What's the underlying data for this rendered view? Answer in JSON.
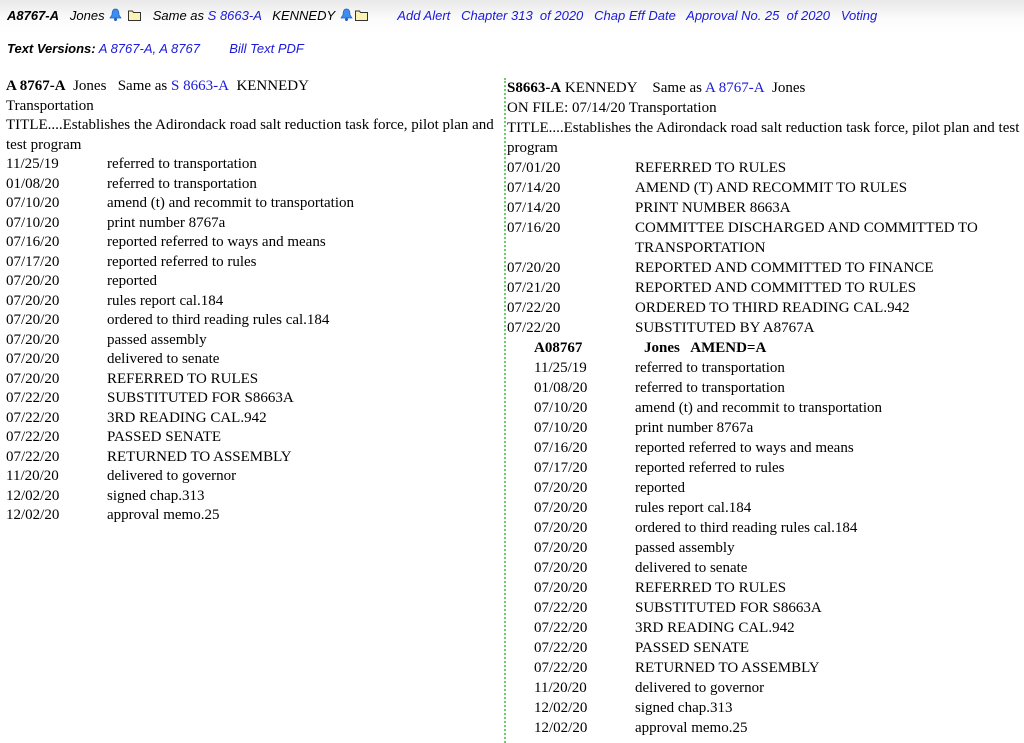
{
  "header": {
    "bill_id": "A8767-A",
    "sponsor": "Jones",
    "same_as_label": "Same as",
    "same_as_link": "S 8663-A",
    "same_as_sponsor": "KENNEDY",
    "links": [
      "Add Alert",
      "Chapter 313  of 2020",
      "Chap Eff Date",
      "Approval No. 25  of 2020",
      "Voting"
    ],
    "text_versions_label": "Text Versions:",
    "text_versions": "A 8767-A, A 8767",
    "bill_text_pdf": "Bill Text PDF"
  },
  "left": {
    "bill_id": "A 8767-A",
    "sponsor": "Jones",
    "same_as_label": "Same as",
    "same_as_link": "S 8663-A",
    "same_as_sponsor": "KENNEDY",
    "committee": "Transportation",
    "title": "TITLE....Establishes the Adirondack road salt reduction task force, pilot plan and test program",
    "events": [
      {
        "date": "11/25/19",
        "action": "referred to transportation"
      },
      {
        "date": "01/08/20",
        "action": "referred to transportation"
      },
      {
        "date": "07/10/20",
        "action": "amend (t) and recommit to transportation"
      },
      {
        "date": "07/10/20",
        "action": "print number 8767a"
      },
      {
        "date": "07/16/20",
        "action": "reported referred to ways and means"
      },
      {
        "date": "07/17/20",
        "action": "reported referred to rules"
      },
      {
        "date": "07/20/20",
        "action": "reported"
      },
      {
        "date": "07/20/20",
        "action": "rules report cal.184"
      },
      {
        "date": "07/20/20",
        "action": "ordered to third reading rules cal.184"
      },
      {
        "date": "07/20/20",
        "action": "passed assembly"
      },
      {
        "date": "07/20/20",
        "action": "delivered to senate"
      },
      {
        "date": "07/20/20",
        "action": "REFERRED TO RULES"
      },
      {
        "date": "07/22/20",
        "action": "SUBSTITUTED FOR S8663A"
      },
      {
        "date": "07/22/20",
        "action": "3RD READING CAL.942"
      },
      {
        "date": "07/22/20",
        "action": "PASSED SENATE"
      },
      {
        "date": "07/22/20",
        "action": "RETURNED TO ASSEMBLY"
      },
      {
        "date": "11/20/20",
        "action": "delivered to governor"
      },
      {
        "date": "12/02/20",
        "action": "signed chap.313"
      },
      {
        "date": "12/02/20",
        "action": "approval memo.25"
      }
    ]
  },
  "right": {
    "bill_id": "S8663-A",
    "sponsor": "KENNEDY",
    "same_as_label": "Same as",
    "same_as_link": "A 8767-A",
    "same_as_sponsor": "Jones",
    "on_file": "ON FILE: 07/14/20 Transportation",
    "title": "TITLE....Establishes the Adirondack road salt reduction task force, pilot plan and test program",
    "events": [
      {
        "date": "07/01/20",
        "action": "REFERRED TO RULES"
      },
      {
        "date": "07/14/20",
        "action": "AMEND (T) AND RECOMMIT TO RULES"
      },
      {
        "date": "07/14/20",
        "action": "PRINT NUMBER 8663A"
      },
      {
        "date": "07/16/20",
        "action": "COMMITTEE DISCHARGED AND COMMITTED TO TRANSPORTATION"
      },
      {
        "date": "07/20/20",
        "action": "REPORTED AND COMMITTED TO FINANCE"
      },
      {
        "date": "07/21/20",
        "action": "REPORTED AND COMMITTED TO RULES"
      },
      {
        "date": "07/22/20",
        "action": "ORDERED TO THIRD READING CAL.942"
      },
      {
        "date": "07/22/20",
        "action": "SUBSTITUTED BY A8767A"
      }
    ],
    "substitute": {
      "bill": "A08767",
      "info": "Jones   AMEND=A",
      "events": [
        {
          "date": "11/25/19",
          "action": "referred to transportation"
        },
        {
          "date": "01/08/20",
          "action": "referred to transportation"
        },
        {
          "date": "07/10/20",
          "action": "amend (t) and recommit to transportation"
        },
        {
          "date": "07/10/20",
          "action": "print number 8767a"
        },
        {
          "date": "07/16/20",
          "action": "reported referred to ways and means"
        },
        {
          "date": "07/17/20",
          "action": "reported referred to rules"
        },
        {
          "date": "07/20/20",
          "action": "reported"
        },
        {
          "date": "07/20/20",
          "action": "rules report cal.184"
        },
        {
          "date": "07/20/20",
          "action": "ordered to third reading rules cal.184"
        },
        {
          "date": "07/20/20",
          "action": "passed assembly"
        },
        {
          "date": "07/20/20",
          "action": "delivered to senate"
        },
        {
          "date": "07/20/20",
          "action": "REFERRED TO RULES"
        },
        {
          "date": "07/22/20",
          "action": "SUBSTITUTED FOR S8663A"
        },
        {
          "date": "07/22/20",
          "action": "3RD READING CAL.942"
        },
        {
          "date": "07/22/20",
          "action": "PASSED SENATE"
        },
        {
          "date": "07/22/20",
          "action": "RETURNED TO ASSEMBLY"
        },
        {
          "date": "11/20/20",
          "action": "delivered to governor"
        },
        {
          "date": "12/02/20",
          "action": "signed chap.313"
        },
        {
          "date": "12/02/20",
          "action": "approval memo.25"
        }
      ]
    }
  }
}
